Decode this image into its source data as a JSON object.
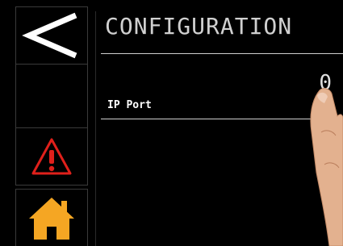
{
  "page": {
    "title": "CONFIGURATION"
  },
  "sidebar": {
    "items": [
      {
        "id": "back",
        "icon": "back-chevron-icon"
      },
      {
        "id": "alarms",
        "icon": "warning-triangle-icon",
        "color": "#e0201b"
      },
      {
        "id": "home",
        "icon": "home-icon",
        "color": "#f5a623"
      }
    ]
  },
  "fields": [
    {
      "label": "IP Port",
      "value": "0"
    }
  ]
}
